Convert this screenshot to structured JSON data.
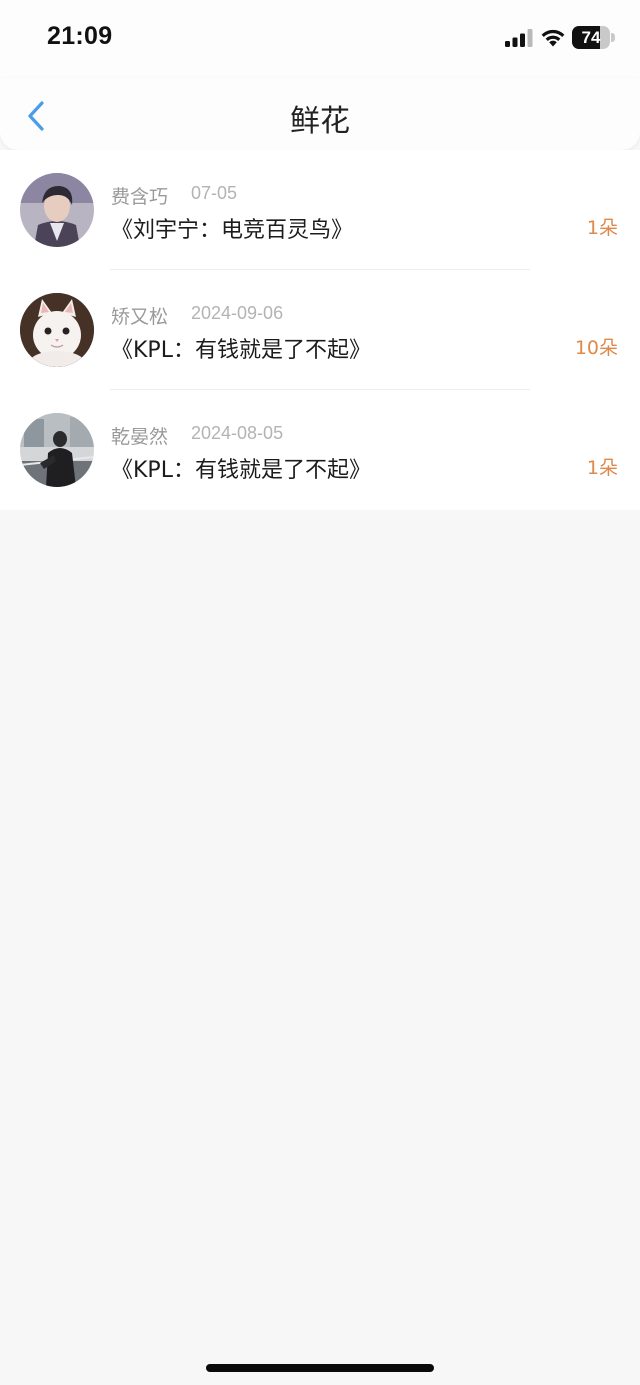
{
  "status_bar": {
    "time": "21:09",
    "battery_level": "74",
    "battery_fraction": 0.74
  },
  "nav": {
    "title": "鲜花",
    "back_icon": "chevron-left-icon",
    "accent_color": "#4a9be8"
  },
  "items": [
    {
      "name": "费含巧",
      "date": "07-05",
      "title": "《刘宇宁：电竞百灵鸟》",
      "count": "1朵",
      "avatar": "avatar-man-portrait"
    },
    {
      "name": "矫又松",
      "date": "2024-09-06",
      "title": "《KPL：有钱就是了不起》",
      "count": "10朵",
      "avatar": "avatar-white-cat"
    },
    {
      "name": "乾晏然",
      "date": "2024-08-05",
      "title": "《KPL：有钱就是了不起》",
      "count": "1朵",
      "avatar": "avatar-street-photo"
    }
  ],
  "colors": {
    "count_orange": "#e0894a",
    "name_gray": "#9a9a9a",
    "background": "#f7f7f7"
  }
}
